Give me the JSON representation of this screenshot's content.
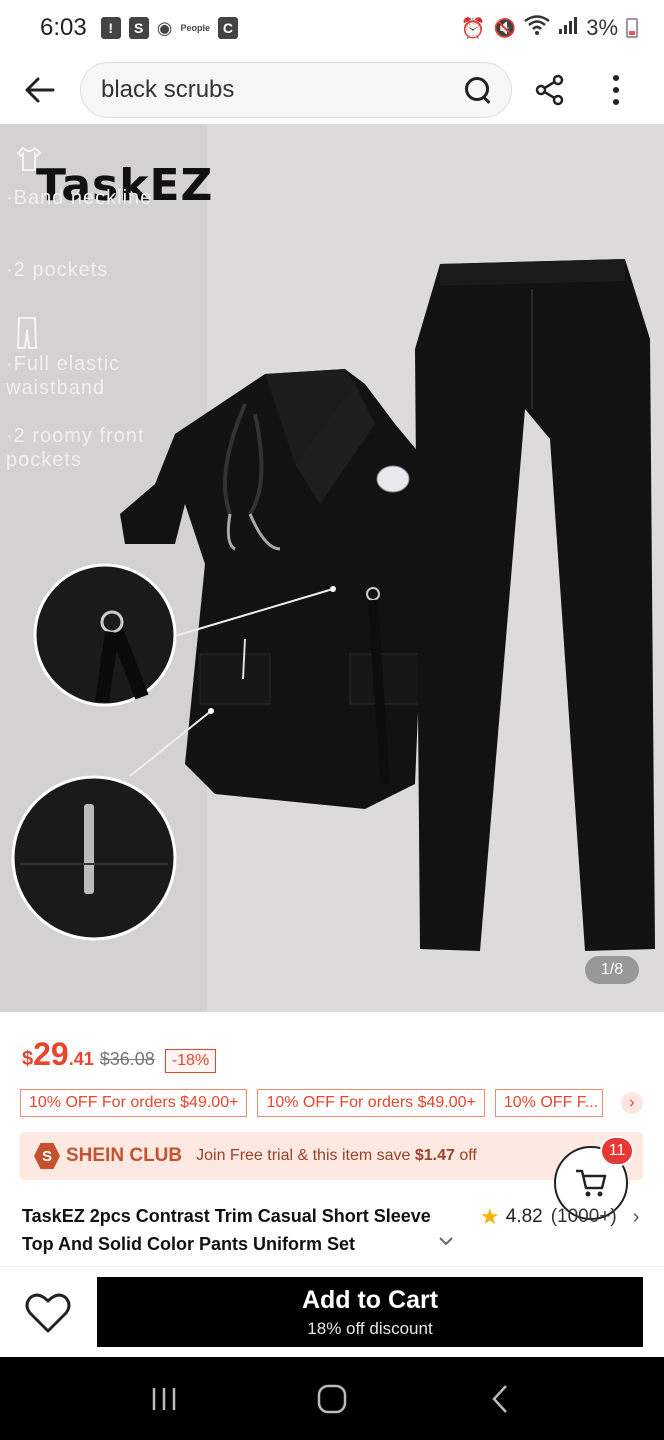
{
  "status_bar": {
    "time": "6:03",
    "battery": "3%",
    "notif_icons": [
      "alert-icon",
      "s-app-icon",
      "chrome-icon",
      "people-icon",
      "c-app-icon"
    ]
  },
  "header": {
    "search_query": "black scrubs"
  },
  "gallery": {
    "brand": "TaskEZ",
    "features": [
      "·Band neckline",
      "·2 pockets",
      "·Full elastic waistband",
      "·2 roomy front pockets"
    ],
    "page_indicator": "1/8"
  },
  "price": {
    "currency": "$",
    "integer": "29",
    "decimal": ".41",
    "original": "$36.08",
    "discount": "-18%"
  },
  "coupons": [
    "10% OFF For orders $49.00+",
    "10% OFF For orders $49.00+",
    "10% OFF F..."
  ],
  "club": {
    "logo_letter": "S",
    "title": "SHEIN CLUB",
    "text": "Join Free trial & this item save ",
    "save_amount": "$1.47",
    "text_end": " off"
  },
  "cart": {
    "badge_count": "11"
  },
  "product": {
    "title": "TaskEZ 2pcs Contrast Trim Casual Short Sleeve Top And Solid Color Pants Uniform Set",
    "rating": "4.82",
    "review_count": "(1000+)"
  },
  "bottom": {
    "add_to_cart": "Add to Cart",
    "discount_note": "18% off discount"
  },
  "colors": {
    "accent": "#e8452d",
    "club_bg": "#fde9e1",
    "cta_bg": "#000000"
  }
}
